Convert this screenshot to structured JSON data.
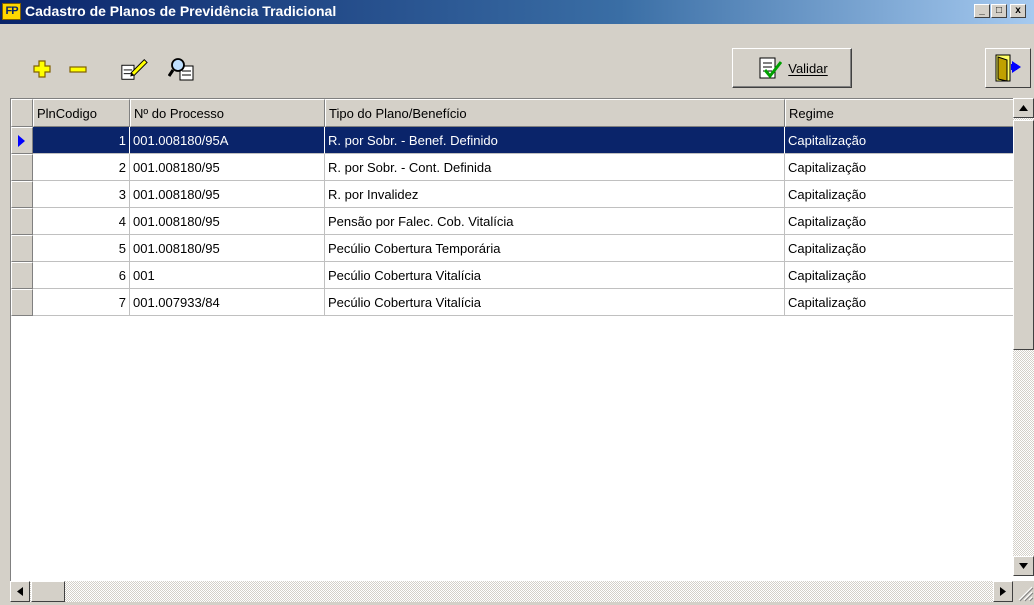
{
  "window": {
    "title": "Cadastro de Planos de Previdência Tradicional",
    "logo_text": "FP",
    "minimize_label": "_",
    "maximize_label": "□",
    "close_label": "x"
  },
  "toolbar": {
    "add_icon": "plus-icon",
    "remove_icon": "minus-icon",
    "edit_icon": "edit-pencil-icon",
    "search_icon": "search-icon",
    "validar_label": "Validar",
    "exit_icon": "exit-door-icon"
  },
  "grid": {
    "columns": [
      "PlnCodigo",
      "Nº do Processo",
      "Tipo do Plano/Benefício",
      "Regime"
    ],
    "rows": [
      {
        "codigo": "1",
        "processo": "001.008180/95A",
        "tipo": "R. por Sobr. - Benef. Definido",
        "regime": "Capitalização",
        "selected": true
      },
      {
        "codigo": "2",
        "processo": "001.008180/95",
        "tipo": "R. por Sobr. - Cont. Definida",
        "regime": "Capitalização",
        "selected": false
      },
      {
        "codigo": "3",
        "processo": "001.008180/95",
        "tipo": "R. por Invalidez",
        "regime": "Capitalização",
        "selected": false
      },
      {
        "codigo": "4",
        "processo": "001.008180/95",
        "tipo": "Pensão por Falec. Cob. Vitalícia",
        "regime": "Capitalização",
        "selected": false
      },
      {
        "codigo": "5",
        "processo": "001.008180/95",
        "tipo": "Pecúlio Cobertura Temporária",
        "regime": "Capitalização",
        "selected": false
      },
      {
        "codigo": "6",
        "processo": "001",
        "tipo": "Pecúlio Cobertura Vitalícia",
        "regime": "Capitalização",
        "selected": false
      },
      {
        "codigo": "7",
        "processo": "001.007933/84",
        "tipo": "Pecúlio Cobertura Vitalícia",
        "regime": "Capitalização",
        "selected": false
      }
    ]
  },
  "colors": {
    "title_bar": "#0a246a",
    "selection": "#0a246a",
    "indicator_arrow": "#0000ff",
    "face": "#d4d0c8"
  }
}
